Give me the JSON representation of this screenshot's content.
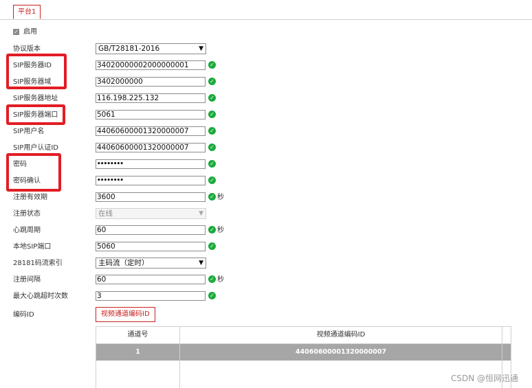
{
  "tabs": [
    {
      "label": "平台1",
      "active": true
    }
  ],
  "enable": {
    "label": "启用",
    "checked": true
  },
  "fields": [
    {
      "label": "协议版本",
      "type": "select",
      "value": "GB/T28181-2016"
    },
    {
      "label": "SIP服务器ID",
      "type": "text",
      "value": "34020000002000000001",
      "ok": true
    },
    {
      "label": "SIP服务器域",
      "type": "text",
      "value": "3402000000",
      "ok": true
    },
    {
      "label": "SIP服务器地址",
      "type": "text",
      "value": "116.198.225.132",
      "ok": true
    },
    {
      "label": "SIP服务器端口",
      "type": "text",
      "value": "5061",
      "ok": true
    },
    {
      "label": "SIP用户名",
      "type": "text",
      "value": "44060600001320000007",
      "ok": true
    },
    {
      "label": "SIP用户认证ID",
      "type": "text",
      "value": "44060600001320000007",
      "ok": true
    },
    {
      "label": "密码",
      "type": "password",
      "value": "••••••••",
      "ok": true
    },
    {
      "label": "密码确认",
      "type": "password",
      "value": "••••••••",
      "ok": true
    },
    {
      "label": "注册有效期",
      "type": "text",
      "value": "3600",
      "ok": true,
      "unit": "秒"
    },
    {
      "label": "注册状态",
      "type": "select-disabled",
      "value": "在线"
    },
    {
      "label": "心跳周期",
      "type": "text",
      "value": "60",
      "ok": true,
      "unit": "秒"
    },
    {
      "label": "本地SIP端口",
      "type": "text",
      "value": "5060",
      "ok": true
    },
    {
      "label": "28181码流索引",
      "type": "select",
      "value": "主码流（定时）"
    },
    {
      "label": "注册间隔",
      "type": "text",
      "value": "60",
      "ok": true,
      "unit": "秒"
    },
    {
      "label": "最大心跳超时次数",
      "type": "text",
      "value": "3",
      "ok": true
    }
  ],
  "encoding": {
    "label": "编码ID",
    "button_label": "视频通道编码ID",
    "table": {
      "headers": [
        "通道号",
        "视频通道编码ID"
      ],
      "rows": [
        [
          "1",
          "44060600001320000007"
        ]
      ]
    }
  },
  "watermark": "CSDN @恒网迅通",
  "colors": {
    "accent": "#c8201f",
    "highlight": "#e11d24",
    "ok": "#1aab3c",
    "selected_row": "#a6a6a6"
  },
  "icons": {
    "ok": "check-circle-icon",
    "dropdown": "chevron-down-icon",
    "checkbox": "checkbox-checked-icon"
  }
}
